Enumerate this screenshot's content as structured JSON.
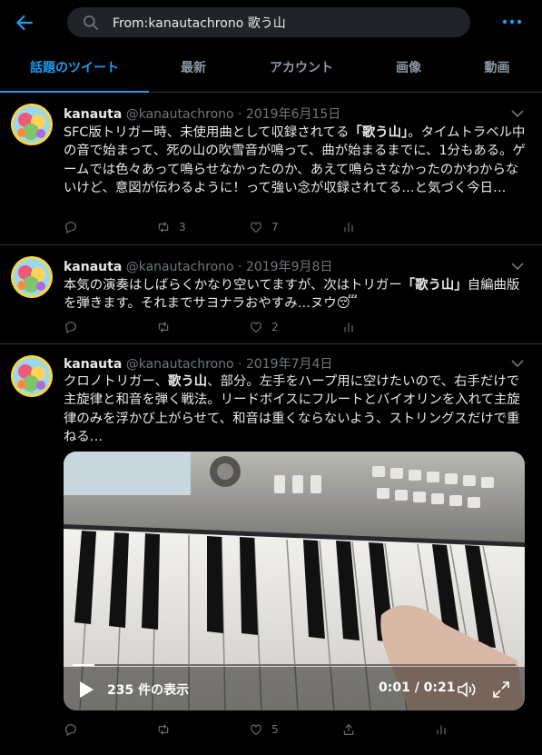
{
  "search": {
    "query": "From:kanautachrono 歌う山"
  },
  "tabs": [
    "話題のツイート",
    "最新",
    "アカウント",
    "画像",
    "動画"
  ],
  "colors": {
    "accent": "#1d9bf0",
    "muted": "#71767b",
    "background": "#000000"
  },
  "tweets": [
    {
      "name": "kanauta",
      "handle": "@kanautachrono",
      "date": "2019年6月15日",
      "text_parts": [
        "SFC版トリガー時、未使用曲として収録されてる",
        "「歌う山」",
        "。タイムトラベル中の音で始まって、死の山の吹雪音が鳴って、曲が始まるまでに、1分もある。ゲームでは色々あって鳴らせなかったのか、あえて鳴らさなかったのかわからないけど、意図が伝わるように！って強い念が収録されてる…と気づく今日…"
      ],
      "replies": "",
      "retweets": "3",
      "likes": "7"
    },
    {
      "name": "kanauta",
      "handle": "@kanautachrono",
      "date": "2019年9月8日",
      "text_parts": [
        "本気の演奏はしばらくかなり空いてますが、次はトリガー",
        "「歌う山」",
        "自編曲版を弾きます。それまでサヨナラおやすみ…ヌウ😴"
      ],
      "replies": "",
      "retweets": "",
      "likes": "2"
    },
    {
      "name": "kanauta",
      "handle": "@kanautachrono",
      "date": "2019年7月4日",
      "text_parts": [
        "クロノトリガー、",
        "歌う山",
        "、部分。左手をハープ用に空けたいので、右手だけで主旋律と和音を弾く戦法。リードボイスにフルートとバイオリンを入れて主旋律のみを浮かび上がらせて、和音は重くならないよう、ストリングスだけで重ねる…"
      ],
      "replies": "",
      "retweets": "",
      "likes": "5",
      "video": {
        "views": "235 件の表示",
        "time": "0:01 / 0:21",
        "progress": 0.05
      }
    }
  ]
}
